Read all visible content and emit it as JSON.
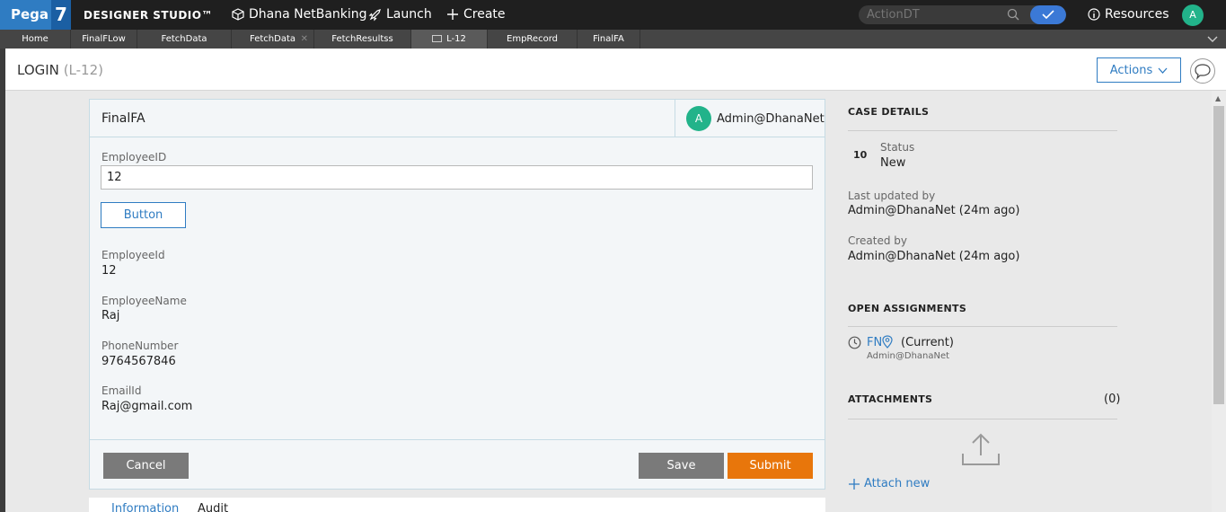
{
  "topbar": {
    "brand": "Pega",
    "brand_version": "7",
    "studio": "DESIGNER STUDIO™",
    "app_name": "Dhana NetBanking",
    "launch_label": "Launch",
    "create_label": "Create",
    "search_placeholder": "ActionDT",
    "resources_label": "Resources",
    "user_initial": "A"
  },
  "tabs": [
    "Home",
    "FinalFLow",
    "FetchData",
    "FetchData",
    "FetchResultss",
    "L-12",
    "EmpRecord",
    "FinalFA"
  ],
  "header": {
    "title": "LOGIN",
    "case_id": "(L-12)",
    "actions_label": "Actions"
  },
  "form": {
    "title": "FinalFA",
    "assignee_initial": "A",
    "assignee": "Admin@DhanaNet",
    "employee_id_label": "EmployeeID",
    "employee_id_value": "12",
    "button_label": "Button",
    "fields": [
      {
        "label": "EmployeeId",
        "value": "12"
      },
      {
        "label": "EmployeeName",
        "value": "Raj"
      },
      {
        "label": "PhoneNumber",
        "value": "9764567846"
      },
      {
        "label": "EmailId",
        "value": "Raj@gmail.com"
      }
    ],
    "cancel_label": "Cancel",
    "save_label": "Save",
    "submit_label": "Submit"
  },
  "subtabs": [
    "Information",
    "Audit"
  ],
  "case_details": {
    "title": "CASE DETAILS",
    "urgency": "10",
    "status_label": "Status",
    "status_value": "New",
    "updated_label": "Last updated by",
    "updated_value": "Admin@DhanaNet (24m ago)",
    "created_label": "Created by",
    "created_value": "Admin@DhanaNet (24m ago)"
  },
  "open_assignments": {
    "title": "OPEN ASSIGNMENTS",
    "name": "FN",
    "state": "(Current)",
    "owner": "Admin@DhanaNet"
  },
  "attachments": {
    "title": "ATTACHMENTS",
    "count": "(0)",
    "attach_label": "Attach new"
  },
  "colors": {
    "brand_blue": "#2f7cc2",
    "submit_orange": "#e8760b",
    "avatar_green": "#22b38a"
  }
}
